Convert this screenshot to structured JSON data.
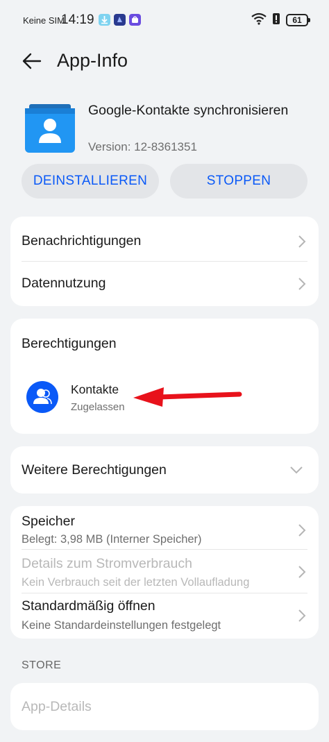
{
  "status_bar": {
    "carrier": "Keine SIM",
    "time": "14:19",
    "battery": "61"
  },
  "header": {
    "title": "App-Info"
  },
  "app": {
    "name": "Google-Kontakte synchronisieren",
    "version": "Version: 12-8361351"
  },
  "actions": {
    "uninstall_label": "DEINSTALLIEREN",
    "stop_label": "STOPPEN"
  },
  "settings_card": {
    "notifications_label": "Benachrichtigungen",
    "data_usage_label": "Datennutzung"
  },
  "permissions_card": {
    "title": "Berechtigungen",
    "item_label": "Kontakte",
    "item_status": "Zugelassen"
  },
  "more_permissions": {
    "label": "Weitere Berechtigungen"
  },
  "details_card": {
    "storage_label": "Speicher",
    "storage_sub": "Belegt: 3,98 MB (Interner Speicher)",
    "power_label": "Details zum Stromverbrauch",
    "power_sub": "Kein Verbrauch seit der letzten Vollaufladung",
    "default_open_label": "Standardmäßig öffnen",
    "default_open_sub": "Keine Standardeinstellungen festgelegt"
  },
  "store": {
    "section_label": "STORE",
    "app_details_label": "App-Details"
  },
  "colors": {
    "accent": "#0a59f7",
    "annotation_arrow": "#e8121b",
    "background": "#f1f3f5"
  }
}
